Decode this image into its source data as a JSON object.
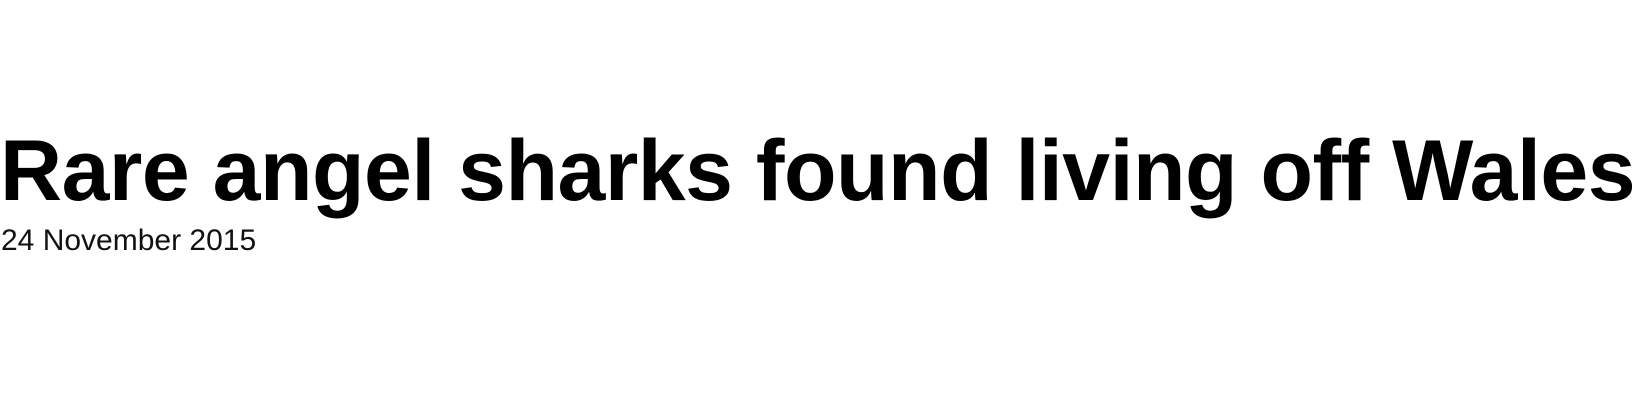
{
  "article": {
    "headline": "Rare angel sharks found living off Wales",
    "date": "24 November 2015"
  }
}
